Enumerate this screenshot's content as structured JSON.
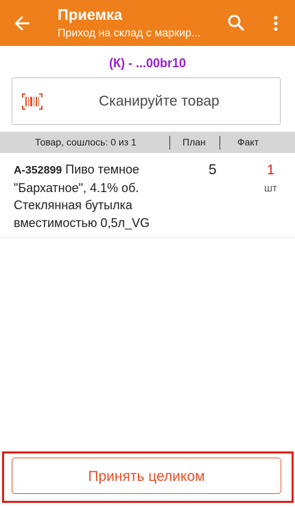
{
  "header": {
    "title": "Приемка",
    "subtitle": "Приход на склад с маркир...",
    "back_icon": "arrow-left-icon",
    "search_icon": "search-icon",
    "more_icon": "more-vertical-icon"
  },
  "document": {
    "code": "(К) - ...00br10"
  },
  "scan": {
    "label": "Сканируйте товар",
    "icon": "barcode-icon"
  },
  "table": {
    "headers": {
      "item": "Товар, сошлось: 0 из 1",
      "plan": "План",
      "fact": "Факт"
    },
    "rows": [
      {
        "article": "А-352899",
        "name": " Пиво темное \"Бархатное\", 4.1% об. Стеклянная бутылка вместимостью 0,5л_VG",
        "plan": "5",
        "fact": "1",
        "unit": "шт"
      }
    ]
  },
  "footer": {
    "accept_label": "Принять целиком"
  },
  "colors": {
    "accent": "#ef7f1a",
    "doc_code": "#9b1fd6",
    "fact": "#e0201a",
    "button": "#e8502a",
    "highlight": "#e0201a"
  }
}
